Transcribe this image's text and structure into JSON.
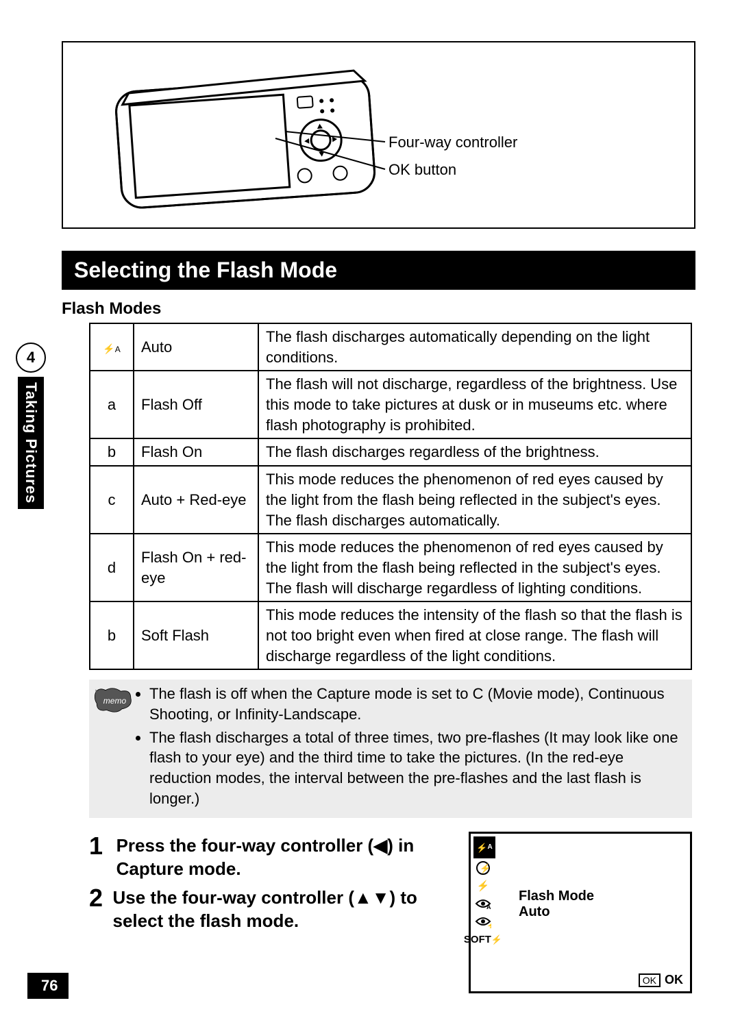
{
  "page_number": "76",
  "side_tab": {
    "chapter": "4",
    "label": "Taking Pictures"
  },
  "diagram": {
    "label1": "Four-way controller",
    "label2": "OK button"
  },
  "heading": "Selecting the Flash Mode",
  "subheading": "Flash Modes",
  "flash_modes": [
    {
      "icon": "⚡A",
      "name": "Auto",
      "desc": "The flash discharges automatically depending on the light conditions."
    },
    {
      "icon": "a",
      "name": "Flash Off",
      "desc": "The flash will not discharge, regardless of the brightness. Use this mode to take pictures at dusk or in museums etc. where flash photography is prohibited."
    },
    {
      "icon": "b",
      "name": "Flash On",
      "desc": "The flash discharges regardless of the brightness."
    },
    {
      "icon": "c",
      "name": "Auto + Red-eye",
      "desc": "This mode reduces the phenomenon of red eyes caused by the light from the flash being reflected in the subject's eyes. The flash discharges automatically."
    },
    {
      "icon": "d",
      "name": "Flash On + red-eye",
      "desc": "This mode reduces the phenomenon of red eyes caused by the light from the flash being reflected in the subject's eyes. The flash will discharge regardless of lighting conditions."
    },
    {
      "icon": "b",
      "name": "Soft Flash",
      "desc": "This mode reduces the intensity of the flash so that the flash is not too bright even when fired at close range. The flash will discharge regardless of the light conditions."
    }
  ],
  "memo": [
    "The flash is off when the Capture mode is set to C (Movie mode), Continuous Shooting, or Infinity-Landscape.",
    "The flash discharges a total of three times, two pre-flashes (It may look like one flash to your eye) and the third time to take the pictures. (In the red-eye reduction modes, the interval between the pre-flashes and the last flash is longer.)"
  ],
  "steps": [
    {
      "num": "1",
      "text": "Press the four-way controller (◀) in Capture mode."
    },
    {
      "num": "2",
      "text": "Use the four-way controller (▲▼) to select the flash mode."
    }
  ],
  "lcd": {
    "title_line1": "Flash Mode",
    "title_line2": "Auto",
    "ok_box": "OK",
    "ok_label": "OK",
    "icons": [
      "⚡A",
      "⚡̲",
      "⚡",
      "👁A",
      "👁",
      "SOFT⚡"
    ]
  }
}
